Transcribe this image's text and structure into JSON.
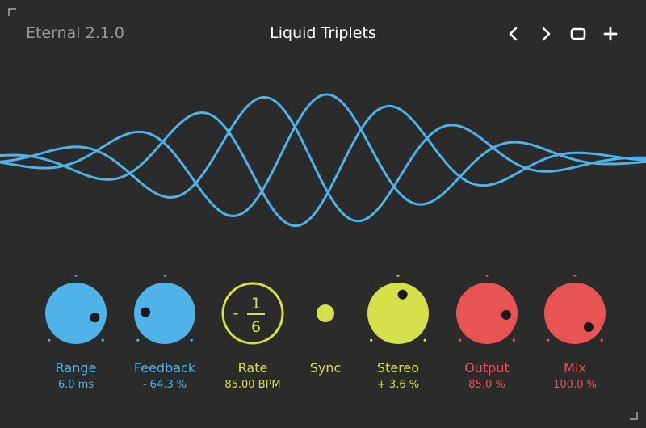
{
  "header": {
    "version": "Eternal 2.1.0",
    "preset_name": "Liquid Triplets"
  },
  "nav": {
    "prev_icon": "chevron-left-icon",
    "next_icon": "chevron-right-icon",
    "window_icon": "square-icon",
    "add_icon": "plus-icon"
  },
  "colors": {
    "background": "#2b2b2b",
    "blue": "#4fb3ea",
    "yellow": "#d6e04a",
    "red": "#e85454",
    "knob_dot": "#1a1a1a"
  },
  "controls": [
    {
      "label": "Range",
      "value": "6.0 ms",
      "color": "blue",
      "type": "knob",
      "level": 0.88
    },
    {
      "label": "Feedback",
      "value": "- 64.3 %",
      "color": "blue",
      "type": "knob",
      "level": 0.18
    },
    {
      "label": "Rate",
      "value": "85.00 BPM",
      "color": "yellow",
      "type": "rate",
      "sign": "-",
      "numerator": "1",
      "denominator": "6"
    },
    {
      "label": "Sync",
      "value": "",
      "color": "yellow",
      "type": "toggle"
    },
    {
      "label": "Stereo",
      "value": "+ 3.6 %",
      "color": "yellow",
      "type": "knob",
      "level": 0.55
    },
    {
      "label": "Output",
      "value": "85.0 %",
      "color": "red",
      "type": "knob",
      "level": 0.85
    },
    {
      "label": "Mix",
      "value": "100.0 %",
      "color": "red",
      "type": "knob",
      "level": 1.0
    }
  ]
}
